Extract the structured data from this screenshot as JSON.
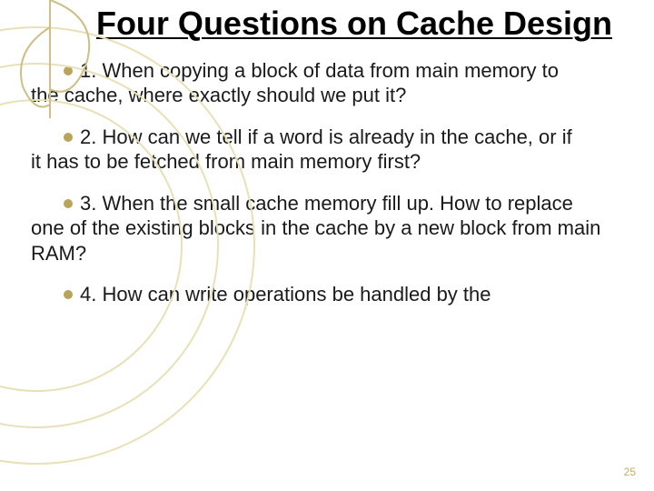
{
  "title": "Four Questions on Cache Design",
  "items": [
    {
      "lead": "1. When copying a block of data from main memory to",
      "rest": "the cache, where exactly should we put it?"
    },
    {
      "lead": "2. How can we tell if a word is already in the cache, or if",
      "rest": "it has to be fetched from main memory first?"
    },
    {
      "lead": "3. When the small cache memory fill up. How to replace",
      "rest": "one of the existing blocks in the cache by a new block from main RAM?"
    },
    {
      "lead": "4. How can write operations be handled by the",
      "rest": ""
    }
  ],
  "page_number": "25"
}
